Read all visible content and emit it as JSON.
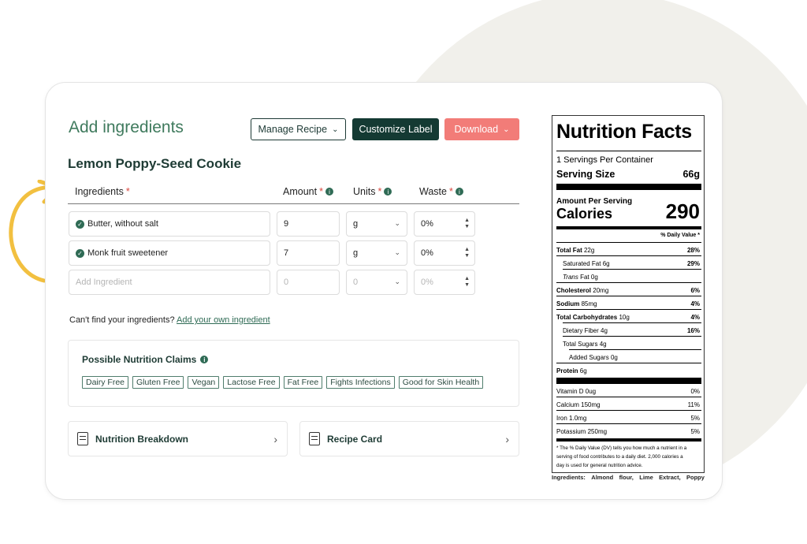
{
  "header": {
    "title": "Add ingredients",
    "manage_recipe_label": "Manage Recipe",
    "customize_label": "Customize Label",
    "download_label": "Download"
  },
  "recipe": {
    "name": "Lemon Poppy-Seed Cookie"
  },
  "columns": {
    "ingredients": "Ingredients",
    "amount": "Amount",
    "units": "Units",
    "waste": "Waste",
    "required_mark": "*"
  },
  "rows": [
    {
      "name": "Butter, without salt",
      "amount": "9",
      "unit": "g",
      "waste": "0%"
    },
    {
      "name": "Monk fruit sweetener",
      "amount": "7",
      "unit": "g",
      "waste": "0%"
    }
  ],
  "new_row": {
    "name_placeholder": "Add Ingredient",
    "amount_placeholder": "0",
    "unit_placeholder": "0",
    "waste_placeholder": "0%"
  },
  "help": {
    "prefix": "Can't find your ingredients?",
    "link": "Add your own ingredient"
  },
  "claims": {
    "title": "Possible Nutrition Claims",
    "tags": [
      "Dairy Free",
      "Gluten Free",
      "Vegan",
      "Lactose Free",
      "Fat Free",
      "Fights Infections",
      "Good for Skin Health"
    ]
  },
  "cards": {
    "breakdown": "Nutrition Breakdown",
    "recipe_card": "Recipe Card"
  },
  "label": {
    "title": "Nutrition Facts",
    "servings": "1 Servings Per Container",
    "serving_size_label": "Serving Size",
    "serving_size_value": "66g",
    "amount_per_serving": "Amount Per Serving",
    "calories_label": "Calories",
    "calories_value": "290",
    "dv_header": "% Daily Value *",
    "total_fat": {
      "name": "Total Fat",
      "amount": "22g",
      "dv": "28%"
    },
    "saturated_fat": {
      "name": "Saturated Fat",
      "amount": "6g",
      "dv": "29%"
    },
    "trans_fat": {
      "name": "Trans",
      "suffix": "Fat",
      "amount": "0g"
    },
    "cholesterol": {
      "name": "Cholesterol",
      "amount": "20mg",
      "dv": "6%"
    },
    "sodium": {
      "name": "Sodium",
      "amount": "85mg",
      "dv": "4%"
    },
    "total_carbs": {
      "name": "Total Carbohydrates",
      "amount": "10g",
      "dv": "4%"
    },
    "fiber": {
      "name": "Dietary Fiber",
      "amount": "4g",
      "dv": "16%"
    },
    "total_sugars": {
      "name": "Total Sugars",
      "amount": "4g"
    },
    "added_sugars": {
      "name": "Added Sugars",
      "amount": "0g"
    },
    "protein": {
      "name": "Protein",
      "amount": "6g"
    },
    "vitamin_d": {
      "name": "Vitamin D",
      "amount": "0ug",
      "dv": "0%"
    },
    "calcium": {
      "name": "Calcium",
      "amount": "150mg",
      "dv": "11%"
    },
    "iron": {
      "name": "Iron",
      "amount": "1.0mg",
      "dv": "5%"
    },
    "potassium": {
      "name": "Potassium",
      "amount": "250mg",
      "dv": "5%"
    },
    "footnote_1": "* The % Daily Value (DV) tells you how much a nutrient in a",
    "footnote_2": "serving of food contributes to a daily diet. 2,000 calories a",
    "footnote_3": "day is used for general nutrition advice.",
    "ingredients_line": [
      "Ingredients:",
      "Almond",
      "flour,",
      "Lime",
      "Extract,",
      "Poppy"
    ]
  },
  "colors": {
    "accent_green": "#3f7a5d",
    "dark_button": "#143a33",
    "download_button": "#f27c78",
    "arrow": "#f2c040"
  }
}
